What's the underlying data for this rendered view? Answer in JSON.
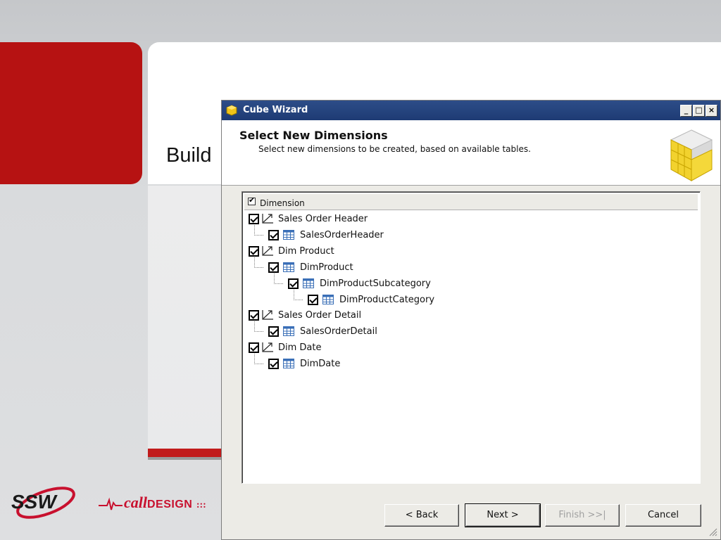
{
  "slide": {
    "title": "Build"
  },
  "logos": {
    "ssw": "SSW",
    "call": "call",
    "design": "DESIGN",
    "dots": ":::"
  },
  "colors": {
    "brand_red": "#b61212",
    "title_bar": "#1e3b74",
    "dialog_bg": "#ecebe6"
  },
  "dialog": {
    "title": "Cube Wizard",
    "controls": {
      "minimize": "_",
      "maximize": "□",
      "close": "×"
    },
    "header": {
      "title": "Select New Dimensions",
      "subtitle": "Select new dimensions to be created, based on available tables."
    },
    "tree": {
      "column_header": "Dimension",
      "nodes": [
        {
          "label": "Sales Order Header",
          "icon": "dimension-icon",
          "level": 0,
          "checked": true
        },
        {
          "label": "SalesOrderHeader",
          "icon": "table-icon",
          "level": 1,
          "checked": true
        },
        {
          "label": "Dim Product",
          "icon": "dimension-icon",
          "level": 0,
          "checked": true
        },
        {
          "label": "DimProduct",
          "icon": "table-icon",
          "level": 1,
          "checked": true
        },
        {
          "label": "DimProductSubcategory",
          "icon": "table-icon",
          "level": 2,
          "checked": true
        },
        {
          "label": "DimProductCategory",
          "icon": "table-icon",
          "level": 3,
          "checked": true
        },
        {
          "label": "Sales Order Detail",
          "icon": "dimension-icon",
          "level": 0,
          "checked": true
        },
        {
          "label": "SalesOrderDetail",
          "icon": "table-icon",
          "level": 1,
          "checked": true
        },
        {
          "label": "Dim Date",
          "icon": "dimension-icon",
          "level": 0,
          "checked": true
        },
        {
          "label": "DimDate",
          "icon": "table-icon",
          "level": 1,
          "checked": true
        }
      ]
    },
    "buttons": {
      "back": "< Back",
      "next": "Next >",
      "finish": "Finish >>|",
      "cancel": "Cancel"
    }
  }
}
